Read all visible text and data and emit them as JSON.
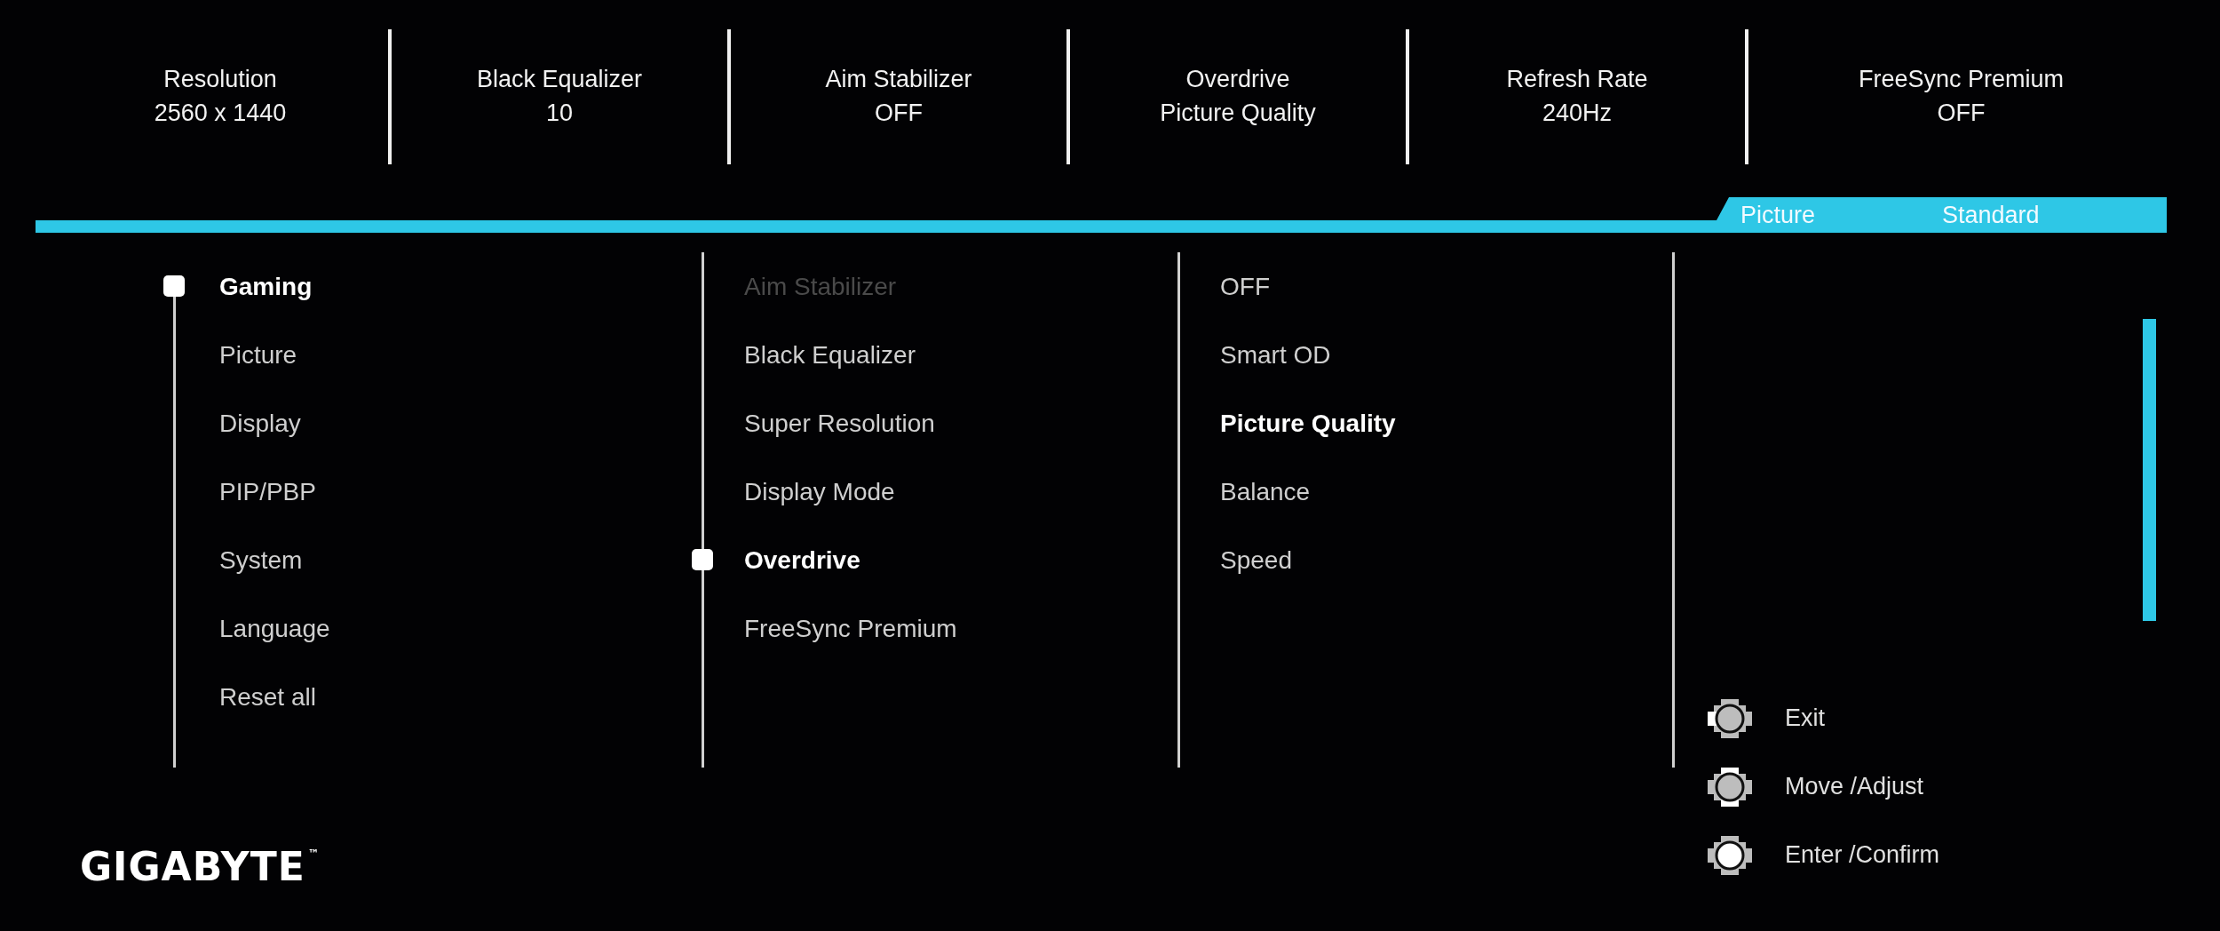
{
  "status_bar": [
    {
      "label": "Resolution",
      "value": "2560 x 1440"
    },
    {
      "label": "Black Equalizer",
      "value": "10"
    },
    {
      "label": "Aim Stabilizer",
      "value": "OFF"
    },
    {
      "label": "Overdrive",
      "value": "Picture Quality"
    },
    {
      "label": "Refresh Rate",
      "value": "240Hz"
    },
    {
      "label": "FreeSync Premium",
      "value": "OFF"
    }
  ],
  "mode_bar": {
    "label": "Picture",
    "value": "Standard"
  },
  "main_menu": [
    {
      "label": "Gaming",
      "selected": true
    },
    {
      "label": "Picture",
      "selected": false
    },
    {
      "label": "Display",
      "selected": false
    },
    {
      "label": "PIP/PBP",
      "selected": false
    },
    {
      "label": "System",
      "selected": false
    },
    {
      "label": "Language",
      "selected": false
    },
    {
      "label": "Reset all",
      "selected": false
    }
  ],
  "sub_menu": [
    {
      "label": "Aim Stabilizer",
      "selected": false,
      "disabled": true
    },
    {
      "label": "Black Equalizer",
      "selected": false,
      "disabled": false
    },
    {
      "label": "Super Resolution",
      "selected": false,
      "disabled": false
    },
    {
      "label": "Display Mode",
      "selected": false,
      "disabled": false
    },
    {
      "label": "Overdrive",
      "selected": true,
      "disabled": false
    },
    {
      "label": "FreeSync Premium",
      "selected": false,
      "disabled": false
    }
  ],
  "options": [
    {
      "label": "OFF",
      "selected": false
    },
    {
      "label": "Smart OD",
      "selected": false
    },
    {
      "label": "Picture Quality",
      "selected": true
    },
    {
      "label": "Balance",
      "selected": false
    },
    {
      "label": "Speed",
      "selected": false
    }
  ],
  "help": [
    {
      "kind": "exit",
      "label": "Exit"
    },
    {
      "kind": "move",
      "label": "Move /Adjust"
    },
    {
      "kind": "enter",
      "label": "Enter /Confirm"
    }
  ],
  "logo": {
    "text": "GIGABYTE",
    "mark": "™"
  }
}
